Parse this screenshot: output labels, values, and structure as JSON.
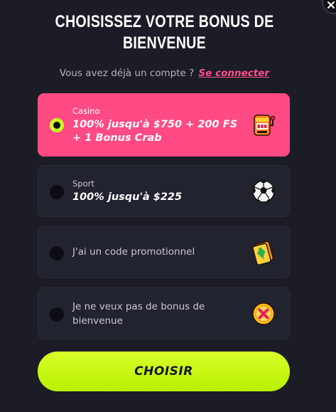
{
  "dialog": {
    "title_line1": "CHOISISSEZ VOTRE BONUS DE",
    "title_line2": "BIENVENUE",
    "login_prompt": "Vous avez déjà un compte ?",
    "login_link": "Se connecter"
  },
  "options": [
    {
      "selected": true,
      "sublabel": "Casino",
      "main_line1": "100% jusqu'à $750 + 200 FS",
      "main_line2": "+ 1 Bonus Crab",
      "icon": "slot-machine-icon"
    },
    {
      "selected": false,
      "sublabel": "Sport",
      "main_line1": "100% jusqu'à $225",
      "icon": "soccer-ball-icon"
    },
    {
      "selected": false,
      "text_line1": "J'ai un code promotionnel",
      "icon": "lucky-ticket-icon"
    },
    {
      "selected": false,
      "text_line1": "Je ne veux pas de bonus de",
      "text_line2": "bienvenue",
      "icon": "no-bonus-coin-icon"
    }
  ],
  "submit_label": "CHOISIR",
  "colors": {
    "background": "#1b1c25",
    "card": "#21232e",
    "selected_card": "#ff4a84",
    "accent_lime": "#c9ff1e",
    "link": "#ff4f8b"
  }
}
